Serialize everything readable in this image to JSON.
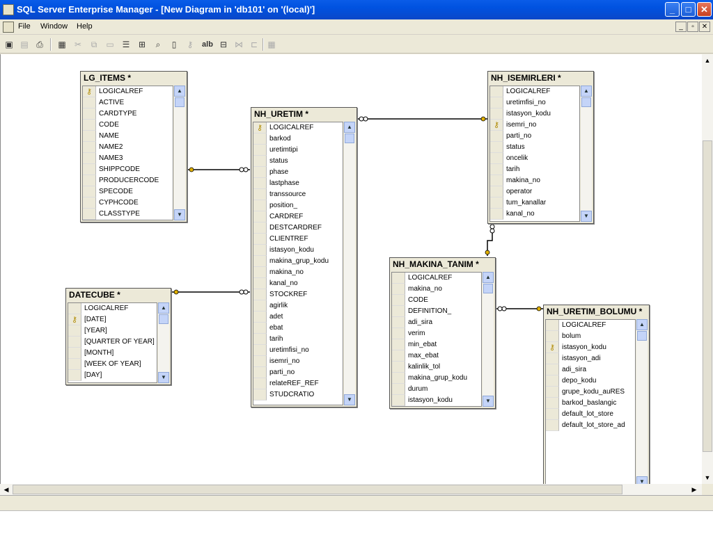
{
  "window": {
    "title": "SQL Server Enterprise Manager - [New Diagram in 'db101' on '(local)']",
    "min": "_",
    "max": "□",
    "close": "✕"
  },
  "menu": {
    "file": "File",
    "window": "Window",
    "help": "Help",
    "mdi_min": "_",
    "mdi_restore": "▫",
    "mdi_close": "✕"
  },
  "toolbar": {
    "icons": [
      "save-icon",
      "properties-icon",
      "print-icon",
      "new-table-icon",
      "cut-icon",
      "copy-icon",
      "paste-icon",
      "insert-rows-icon",
      "add-table-icon",
      "zoom-icon",
      "new-text-icon",
      "key-icon",
      "arrange-icon",
      "show-relationships-icon",
      "tree-icon",
      "table-view-icon"
    ],
    "text_button": "alb"
  },
  "tables": [
    {
      "name": "LG_ITEMS *",
      "rows": [
        {
          "c": "LOGICALREF",
          "k": true
        },
        {
          "c": "ACTIVE"
        },
        {
          "c": "CARDTYPE"
        },
        {
          "c": "CODE"
        },
        {
          "c": "NAME"
        },
        {
          "c": "NAME2"
        },
        {
          "c": "NAME3"
        },
        {
          "c": "SHIPPCODE"
        },
        {
          "c": "PRODUCERCODE"
        },
        {
          "c": "SPECODE"
        },
        {
          "c": "CYPHCODE"
        },
        {
          "c": "CLASSTYPE"
        }
      ]
    },
    {
      "name": "NH_URETIM *",
      "rows": [
        {
          "c": "LOGICALREF",
          "k": true
        },
        {
          "c": "barkod"
        },
        {
          "c": "uretimtipi"
        },
        {
          "c": "status"
        },
        {
          "c": "phase"
        },
        {
          "c": "lastphase"
        },
        {
          "c": "transsource"
        },
        {
          "c": "position_"
        },
        {
          "c": "CARDREF"
        },
        {
          "c": "DESTCARDREF"
        },
        {
          "c": "CLIENTREF"
        },
        {
          "c": "istasyon_kodu"
        },
        {
          "c": "makina_grup_kodu"
        },
        {
          "c": "makina_no"
        },
        {
          "c": "kanal_no"
        },
        {
          "c": "STOCKREF"
        },
        {
          "c": "agirlik"
        },
        {
          "c": "adet"
        },
        {
          "c": "ebat"
        },
        {
          "c": "tarih"
        },
        {
          "c": "uretimfisi_no"
        },
        {
          "c": "isemri_no"
        },
        {
          "c": "parti_no"
        },
        {
          "c": "relateREF_REF"
        },
        {
          "c": "STUDCRATIO"
        }
      ]
    },
    {
      "name": "NH_ISEMIRLERI *",
      "rows": [
        {
          "c": "LOGICALREF"
        },
        {
          "c": "uretimfisi_no"
        },
        {
          "c": "istasyon_kodu"
        },
        {
          "c": "isemri_no",
          "k": true
        },
        {
          "c": "parti_no"
        },
        {
          "c": "status"
        },
        {
          "c": "oncelik"
        },
        {
          "c": "tarih"
        },
        {
          "c": "makina_no"
        },
        {
          "c": "operator"
        },
        {
          "c": "tum_kanallar"
        },
        {
          "c": "kanal_no"
        }
      ]
    },
    {
      "name": "DATECUBE *",
      "rows": [
        {
          "c": "LOGICALREF"
        },
        {
          "c": "[DATE]",
          "k": true
        },
        {
          "c": "[YEAR]"
        },
        {
          "c": "[QUARTER OF YEAR]"
        },
        {
          "c": "[MONTH]"
        },
        {
          "c": "[WEEK OF YEAR]"
        },
        {
          "c": "[DAY]"
        }
      ]
    },
    {
      "name": "NH_MAKINA_TANIM *",
      "rows": [
        {
          "c": "LOGICALREF"
        },
        {
          "c": "makina_no"
        },
        {
          "c": "CODE"
        },
        {
          "c": "DEFINITION_"
        },
        {
          "c": "adi_sira"
        },
        {
          "c": "verim"
        },
        {
          "c": "min_ebat"
        },
        {
          "c": "max_ebat"
        },
        {
          "c": "kalinlik_tol"
        },
        {
          "c": "makina_grup_kodu"
        },
        {
          "c": "durum"
        },
        {
          "c": "istasyon_kodu"
        }
      ]
    },
    {
      "name": "NH_URETIM_BOLUMU *",
      "rows": [
        {
          "c": "LOGICALREF"
        },
        {
          "c": "bolum"
        },
        {
          "c": "istasyon_kodu",
          "k": true
        },
        {
          "c": "istasyon_adi"
        },
        {
          "c": "adi_sira"
        },
        {
          "c": "depo_kodu"
        },
        {
          "c": "grupe_kodu_auRES"
        },
        {
          "c": "barkod_baslangic"
        },
        {
          "c": "default_lot_store"
        },
        {
          "c": "default_lot_store_ad"
        }
      ]
    }
  ]
}
